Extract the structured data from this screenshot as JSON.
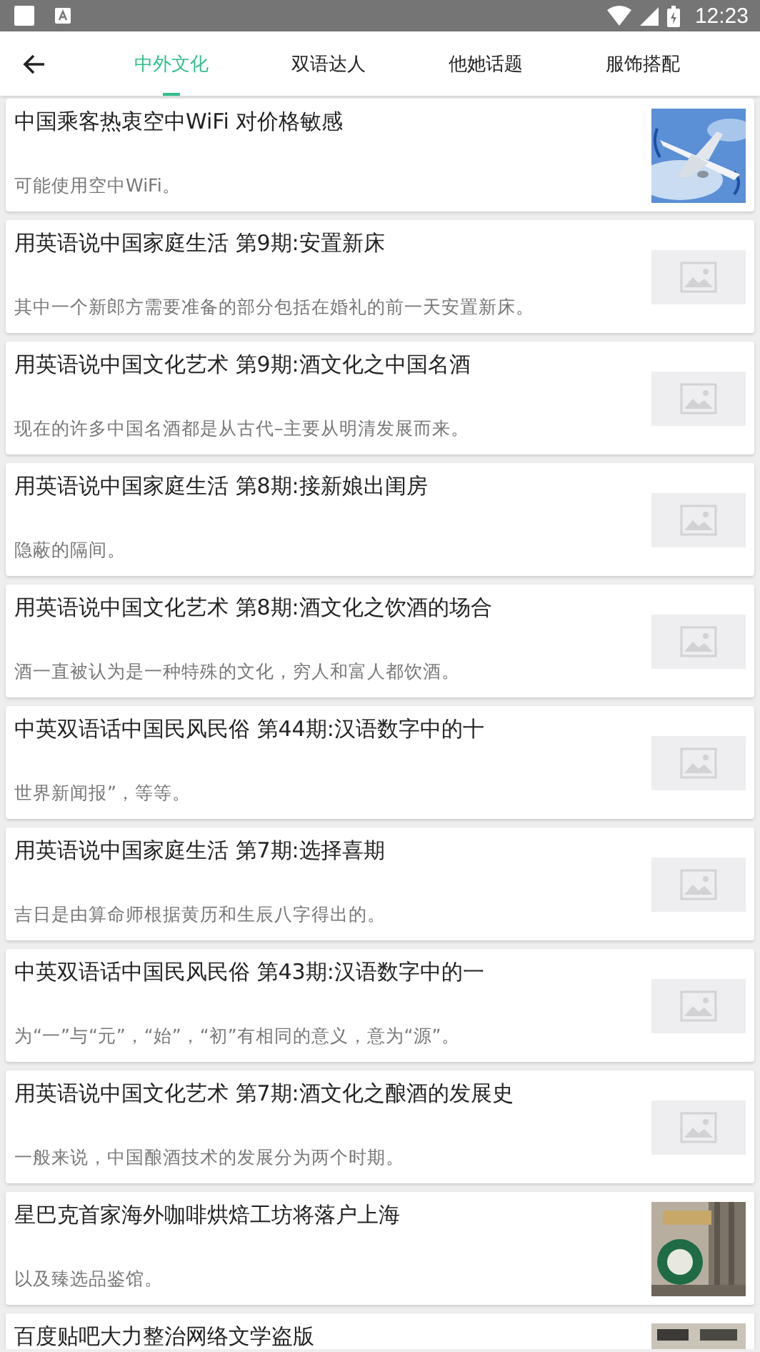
{
  "status_bar": {
    "time": "12:23"
  },
  "tabs": [
    {
      "label": "中外文化",
      "selected": true
    },
    {
      "label": "双语达人",
      "selected": false
    },
    {
      "label": "他她话题",
      "selected": false
    },
    {
      "label": "服饰搭配",
      "selected": false
    }
  ],
  "articles": [
    {
      "title": "中国乘客热衷空中WiFi 对价格敏感",
      "summary": "可能使用空中WiFi。"
    },
    {
      "title": "用英语说中国家庭生活 第9期:安置新床",
      "summary": "其中一个新郎方需要准备的部分包括在婚礼的前一天安置新床。",
      "image": {
        "kind": "placeholder"
      }
    },
    {
      "title": "用英语说中国文化艺术 第9期:酒文化之中国名酒",
      "summary": "现在的许多中国名酒都是从古代–主要从明清发展而来。",
      "image": {
        "kind": "placeholder"
      }
    },
    {
      "title": "用英语说中国家庭生活 第8期:接新娘出闺房",
      "summary": "隐蔽的隔间。",
      "image": {
        "kind": "placeholder"
      }
    },
    {
      "title": "用英语说中国文化艺术 第8期:酒文化之饮酒的场合",
      "summary": "酒一直被认为是一种特殊的文化，穷人和富人都饮酒。",
      "image": {
        "kind": "placeholder"
      }
    },
    {
      "title": "中英双语话中国民风民俗 第44期:汉语数字中的十",
      "summary": "世界新闻报”，等等。",
      "image": {
        "kind": "placeholder"
      }
    },
    {
      "title": "用英语说中国家庭生活 第7期:选择喜期",
      "summary": "吉日是由算命师根据黄历和生辰八字得出的。",
      "image": {
        "kind": "placeholder"
      }
    },
    {
      "title": "中英双语话中国民风民俗 第43期:汉语数字中的一",
      "summary": "为“一”与“元”，“始”，“初”有相同的意义，意为“源”。",
      "image": {
        "kind": "placeholder"
      }
    },
    {
      "title": "用英语说中国文化艺术 第7期:酒文化之酿酒的发展史",
      "summary": "一般来说，中国酿酒技术的发展分为两个时期。",
      "image": {
        "kind": "placeholder"
      }
    },
    {
      "title": "星巴克首家海外咖啡烘焙工坊将落户上海",
      "summary": "以及臻选品鉴馆。"
    },
    {
      "title": "百度贴吧大力整治网络文学盗版"
    }
  ]
}
